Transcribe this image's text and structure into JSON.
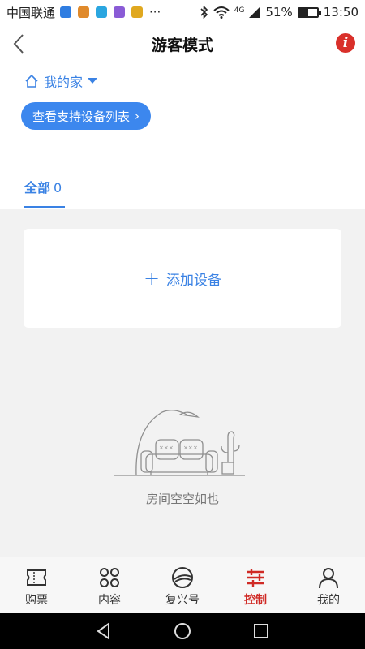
{
  "status_bar": {
    "carrier": "中国联通",
    "battery_percent": "51%",
    "battery_level": 0.51,
    "time": "13:50",
    "network": "4G",
    "icons": [
      "bluetooth-icon",
      "wifi-icon",
      "signal-icon",
      "battery-icon"
    ]
  },
  "header": {
    "title": "游客模式",
    "back_icon": "chevron-left-icon",
    "info_icon": "info-icon",
    "info_glyph": "i"
  },
  "home": {
    "name": "我的家",
    "support_button": "查看支持设备列表",
    "support_chevron": "›"
  },
  "tabs": [
    {
      "label": "全部",
      "count": "0"
    }
  ],
  "add_device": {
    "plus": "+",
    "label": "添加设备"
  },
  "empty_state": {
    "text": "房间空空如也"
  },
  "bottom_nav": {
    "items": [
      {
        "label": "购票",
        "icon": "ticket-icon"
      },
      {
        "label": "内容",
        "icon": "grid-icon"
      },
      {
        "label": "复兴号",
        "icon": "train-icon"
      },
      {
        "label": "控制",
        "icon": "sliders-icon"
      },
      {
        "label": "我的",
        "icon": "person-icon"
      }
    ],
    "active_index": 3
  },
  "colors": {
    "accent": "#3a82e4",
    "button_blue": "#3c87ee",
    "active_red": "#d02a25",
    "info_red": "#d9302a"
  }
}
